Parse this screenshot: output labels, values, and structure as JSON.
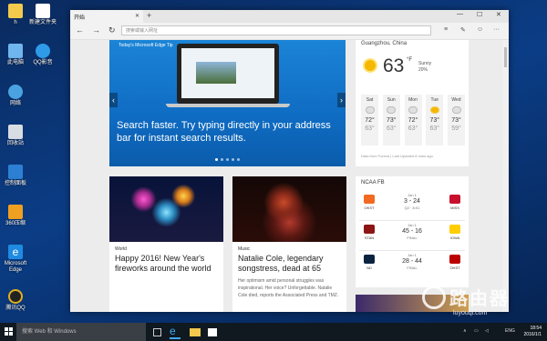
{
  "desktop": {
    "icons": [
      {
        "label": "h"
      },
      {
        "label": "新建文件夹"
      },
      {
        "label": "此电脑"
      },
      {
        "label": "QQ影音"
      },
      {
        "label": "网络"
      },
      {
        "label": "回收站"
      },
      {
        "label": "控制面板"
      },
      {
        "label": "360压缩"
      },
      {
        "label": "Microsoft Edge"
      },
      {
        "label": "腾讯QQ"
      }
    ]
  },
  "browser": {
    "tab_title": "开始",
    "address_placeholder": "搜索或输入网址",
    "hero": {
      "tag": "Today's Microsoft Edge Tip",
      "headline": "Search faster. Try typing directly in your address bar for instant search results."
    },
    "weather": {
      "location": "Guangzhou, China",
      "temp": "63",
      "unit": "°F",
      "condition": "Sunny",
      "precip": "20%",
      "source": "Data from Foreca | Last Updated 8 mins ago",
      "forecast": [
        {
          "day": "Sat",
          "hi": "72°",
          "lo": "63°",
          "sunny": false
        },
        {
          "day": "Sun",
          "hi": "73°",
          "lo": "63°",
          "sunny": false
        },
        {
          "day": "Mon",
          "hi": "72°",
          "lo": "63°",
          "sunny": false
        },
        {
          "day": "Tue",
          "hi": "73°",
          "lo": "63°",
          "sunny": true
        },
        {
          "day": "Wed",
          "hi": "73°",
          "lo": "59°",
          "sunny": false
        }
      ]
    },
    "news": [
      {
        "category": "World",
        "title": "Happy 2016! New Year's fireworks around the world"
      },
      {
        "category": "Music",
        "title": "Natalie Cole, legendary songstress, dead at 65",
        "snippet": "Her optimism amid personal struggles was inspirational. Her voice? Unforgettable. Natalie Cole died, reports the Associated Press and TMZ."
      }
    ],
    "ncaa": {
      "header": "NCAA FB",
      "games": [
        {
          "away": "OKST",
          "home": "MISS",
          "date": "Jan 1",
          "score": "3 - 24",
          "status": "Q2 · 8:01"
        },
        {
          "away": "STAN",
          "home": "IOWA",
          "date": "Jan 1",
          "score": "45 - 16",
          "status": "FINAL"
        },
        {
          "away": "ND",
          "home": "OHST",
          "date": "Jan 1",
          "score": "28 - 44",
          "status": "FINAL"
        }
      ]
    }
  },
  "taskbar": {
    "search_placeholder": "搜索 Web 和 Windows",
    "lang": "ENG",
    "time": "18:54",
    "date": "2016/1/1"
  },
  "watermark": {
    "text": "路由器",
    "sub": "luyouqi.com"
  }
}
